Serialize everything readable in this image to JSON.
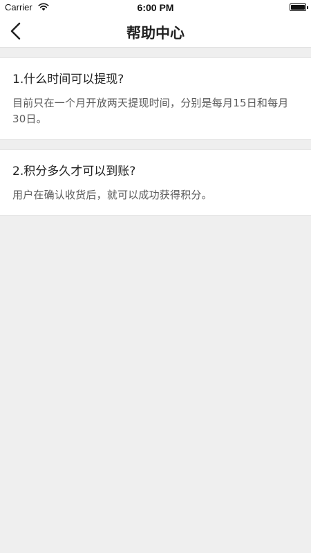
{
  "status_bar": {
    "carrier": "Carrier",
    "time": "6:00 PM",
    "icons": [
      "wifi-icon",
      "battery-icon"
    ]
  },
  "nav": {
    "back_icon": "chevron-left-icon",
    "title": "帮助中心"
  },
  "faq": [
    {
      "question": "1.什么时间可以提现?",
      "answer": "目前只在一个月开放两天提现时间，分别是每月15日和每月30日。"
    },
    {
      "question": "2.积分多久才可以到账?",
      "answer": "用户在确认收货后，就可以成功获得积分。"
    }
  ],
  "colors": {
    "background": "#efefef",
    "card": "#ffffff",
    "question_text": "#222222",
    "answer_text": "#5c5c5c"
  }
}
